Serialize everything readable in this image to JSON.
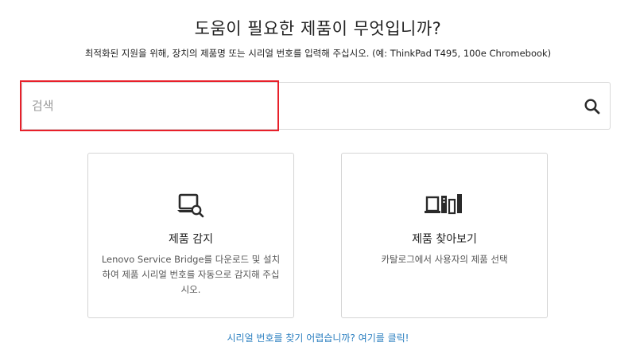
{
  "header": {
    "title": "도움이 필요한 제품이 무엇입니까?",
    "subtitle": "최적화된 지원을 위해, 장치의 제품명 또는 시리얼 번호를 입력해 주십시오. (예: ThinkPad T495, 100e Chromebook)"
  },
  "search": {
    "value": "",
    "placeholder": "검색",
    "icon": "search-icon"
  },
  "cards": [
    {
      "title": "제품 감지",
      "description": "Lenovo Service Bridge를 다운로드 및 설치하여 제품 시리얼 번호를 자동으로 감지해 주십시오.",
      "icon": "laptop-search-icon"
    },
    {
      "title": "제품 찾아보기",
      "description": "카탈로그에서 사용자의 제품 선택",
      "icon": "device-catalog-icon"
    }
  ],
  "footer": {
    "help_link": "시리얼 번호를 찾기 어렵습니까? 여기를 클릭!"
  },
  "colors": {
    "highlight": "#e8202a",
    "link": "#2b7fc0",
    "icon": "#2a2a2a",
    "border": "#d5d5d5"
  }
}
